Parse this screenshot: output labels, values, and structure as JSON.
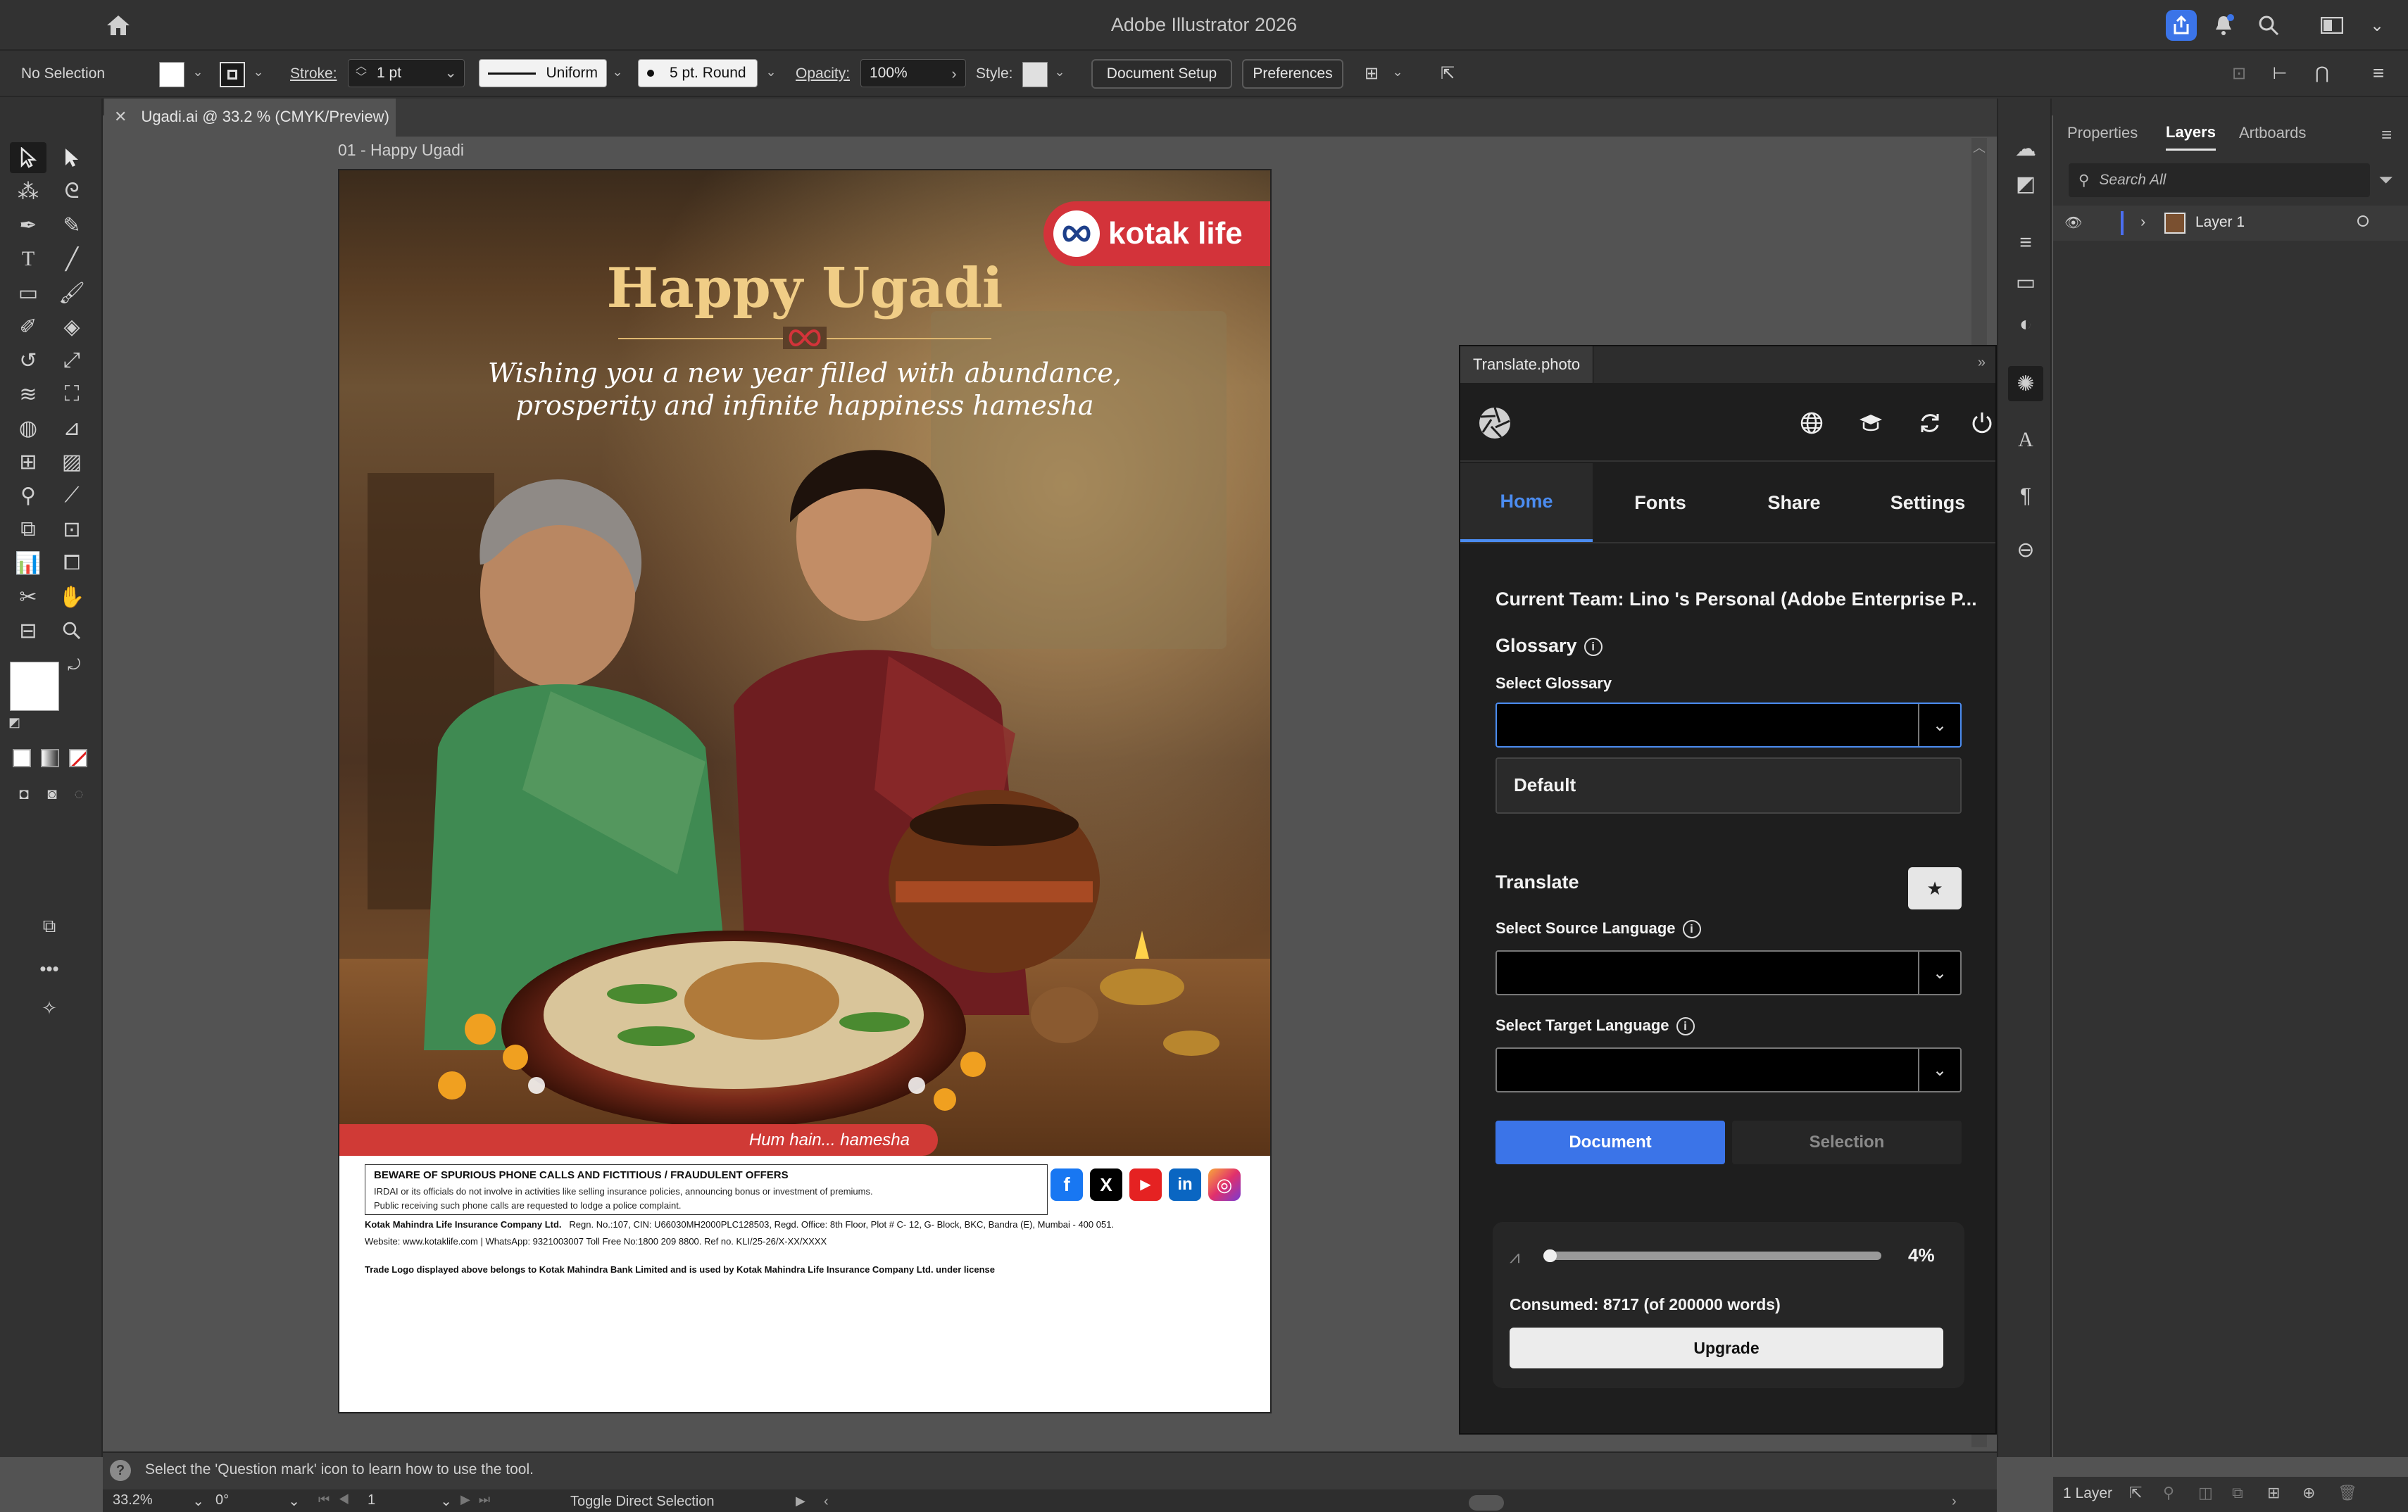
{
  "app": {
    "title": "Adobe Illustrator 2026"
  },
  "control_bar": {
    "selection": "No Selection",
    "stroke_label": "Stroke:",
    "stroke_value": "1 pt",
    "stroke_profile": "Uniform",
    "brush": "5 pt. Round",
    "opacity_label": "Opacity:",
    "opacity_value": "100%",
    "style_label": "Style:",
    "document_setup": "Document Setup",
    "preferences": "Preferences"
  },
  "document": {
    "tab_title": "Ugadi.ai @ 33.2 % (CMYK/Preview)",
    "artboard_name": "01 - Happy Ugadi"
  },
  "artwork": {
    "brand_logo": "kotak life",
    "headline": "Happy Ugadi",
    "subline_1": "Wishing you a new year filled with abundance,",
    "subline_2": "prosperity and infinite happiness hamesha",
    "tagline": "Hum hain... hamesha",
    "warning_title": "BEWARE OF SPURIOUS PHONE CALLS AND FICTITIOUS / FRAUDULENT OFFERS",
    "warning_line1": "IRDAI or its officials do not involve in activities like selling insurance policies, announcing bonus or investment of premiums.",
    "warning_line2": "Public receiving such phone calls are requested to lodge a police complaint.",
    "company": "Kotak Mahindra Life Insurance Company Ltd.",
    "company_info": "Regn. No.:107, CIN: U66030MH2000PLC128503, Regd. Office: 8th Floor, Plot # C- 12, G- Block, BKC, Bandra (E), Mumbai - 400 051.",
    "contact": "Website: www.kotaklife.com | WhatsApp: 9321003007 Toll Free No:1800 209 8800. Ref no. KLI/25-26/X-XX/XXXX",
    "trade_note": "Trade Logo displayed above belongs to Kotak Mahindra Bank Limited and is used by Kotak Mahindra Life Insurance Company Ltd. under license",
    "social": [
      "f",
      "X",
      "▶",
      "in",
      "◎"
    ]
  },
  "panel": {
    "title": "Translate.photo",
    "tabs": [
      "Home",
      "Fonts",
      "Share",
      "Settings"
    ],
    "current_team": "Current Team: Lino 's Personal (Adobe Enterprise P...",
    "glossary_label": "Glossary",
    "select_glossary": "Select Glossary",
    "glossary_option": "Default",
    "translate_label": "Translate",
    "source_label": "Select Source Language",
    "target_label": "Select Target Language",
    "document_btn": "Document",
    "selection_btn": "Selection",
    "progress_percent": "4%",
    "progress_fraction": 0.04,
    "consumed": "Consumed: 8717 (of 200000 words)",
    "upgrade": "Upgrade"
  },
  "layers_panel": {
    "tabs": [
      "Properties",
      "Layers",
      "Artboards"
    ],
    "search_placeholder": "Search All",
    "layer_name": "Layer 1",
    "footer": "1 Layer"
  },
  "status": {
    "hint": "Select the 'Question mark' icon to learn how to use the tool.",
    "zoom": "33.2%",
    "rotation": "0°",
    "artboard_no": "1",
    "tool_status": "Toggle Direct Selection"
  },
  "colors": {
    "accent_blue": "#3b74e8",
    "kotak_red": "#d3333a",
    "headline_gold": "#f0cd86"
  }
}
